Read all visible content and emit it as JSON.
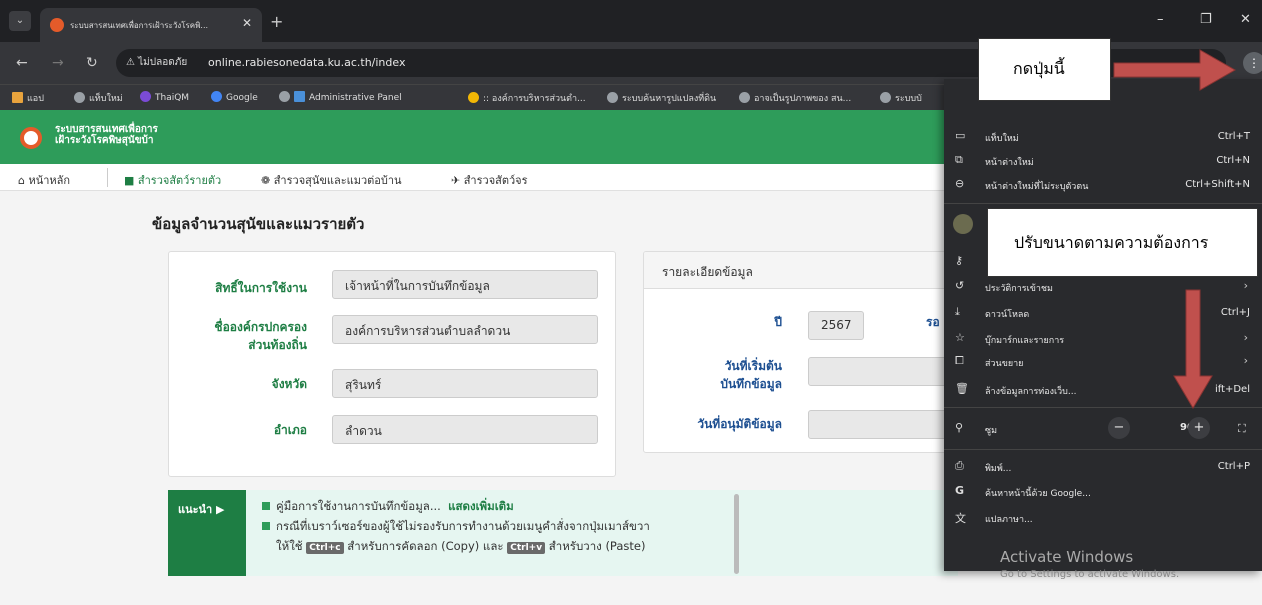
{
  "browser": {
    "tab_title": "ระบบสารสนเทศเพื่อการเฝ้าระวังโรคพิ...",
    "security_label": "ไม่ปลอดภัย",
    "url": "online.rabiesonedata.ku.ac.th/index",
    "bookmarks": [
      "แอป",
      "แท็บใหม่",
      "ThaiQM",
      "Google",
      "Administrative Panel",
      ":: องค์การบริหารส่วนตำ...",
      "ระบบค้นหารูปแปลงที่ดิน",
      "อาจเป็นรูปภาพของ สน...",
      "ระบบบั"
    ]
  },
  "app": {
    "name_line1": "ระบบสารสนเทศเพื่อการ",
    "name_line2": "เฝ้าระวังโรคพิษสุนัขบ้า",
    "nav": [
      "หน้าหลัก",
      "สำรวจสัตว์รายตัว",
      "สำรวจสุนัขและแมวต่อบ้าน",
      "สำรวจสัตว์จร"
    ]
  },
  "page": {
    "title": "ข้อมูลจำนวนสุนัขและแมวรายตัว",
    "form": {
      "rights_label": "สิทธิ์ในการใช้งาน",
      "rights_value": "เจ้าหน้าที่ในการบันทึกข้อมูล",
      "org_label_1": "ชื่อองค์กรปกครอง",
      "org_label_2": "ส่วนท้องถิ่น",
      "org_value": "องค์การบริหารส่วนตำบลลำดวน",
      "province_label": "จังหวัด",
      "province_value": "สุรินทร์",
      "district_label": "อำเภอ",
      "district_value": "ลำดวน"
    },
    "details": {
      "header": "รายละเอียดข้อมูล",
      "year_label": "ปี",
      "year_value": "2567",
      "round_label": "รอ",
      "start_label_1": "วันที่เริ่มต้น",
      "start_label_2": "บันทึกข้อมูล",
      "approve_label": "วันที่อนุมัติข้อมูล"
    },
    "advice": {
      "tag": "แนะนำ ▶",
      "line1": "คู่มือการใช้งานการบันทึกข้อมูล...",
      "more": "แสดงเพิ่มเติม",
      "line2": "กรณีที่เบราว์เซอร์ของผู้ใช้ไม่รองรับการทำงานด้วยเมนูคำสั่งจากปุ่มเมาส์ขวา",
      "line3_a": "ให้ใช้",
      "kbd_copy": "Ctrl+c",
      "line3_b": "สำหรับการคัดลอก (Copy) และ",
      "kbd_paste": "Ctrl+v",
      "line3_c": "สำหรับวาง (Paste)"
    }
  },
  "menu": {
    "new_tab": "แท็บใหม่",
    "new_tab_sc": "Ctrl+T",
    "new_window": "หน้าต่างใหม่",
    "new_window_sc": "Ctrl+N",
    "incognito": "หน้าต่างใหม่ที่ไม่ระบุตัวตน",
    "incognito_sc": "Ctrl+Shift+N",
    "history": "ประวัติการเข้าชม",
    "downloads": "ดาวน์โหลด",
    "downloads_sc": "Ctrl+J",
    "bookmarks": "บุ๊กมาร์กและรายการ",
    "extensions": "ส่วนขยาย",
    "clear": "ล้างข้อมูลการท่องเว็บ...",
    "clear_sc": "ift+Del",
    "zoom": "ซูม",
    "zoom_value": "90%",
    "print": "พิมพ์...",
    "print_sc": "Ctrl+P",
    "search_google": "ค้นหาหน้านี้ด้วย Google...",
    "translate": "แปลภาษา..."
  },
  "callouts": {
    "press_button": "กดปุ่มนี้",
    "resize": "ปรับขนาดตามความต้องการ"
  },
  "watermark": {
    "line1": "Activate Windows",
    "line2": "Go to Settings to activate Windows."
  },
  "colors": {
    "app_green": "#2e9c5a",
    "label_green": "#1e7e44",
    "arrow_red": "#c0504d"
  }
}
